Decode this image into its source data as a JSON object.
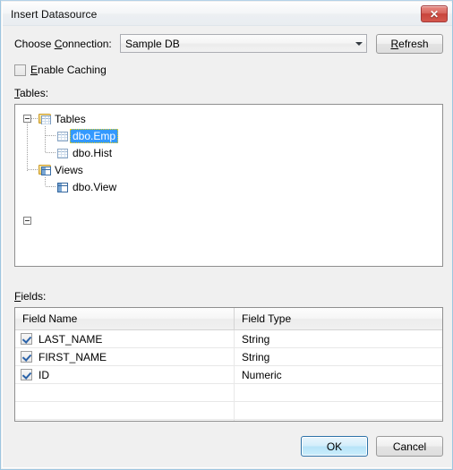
{
  "window": {
    "title": "Insert Datasource",
    "close_icon": "close-icon",
    "close_glyph": "✕"
  },
  "connection": {
    "label_pre": "Choose ",
    "label_mnemonic": "C",
    "label_post": "onnection:",
    "selected": "Sample DB",
    "dropdown_icon": "chevron-down-icon",
    "refresh_pre": "",
    "refresh_mnemonic": "R",
    "refresh_post": "efresh"
  },
  "caching": {
    "label_pre": "",
    "label_mnemonic": "E",
    "label_post": "nable Caching",
    "checked": false
  },
  "tables": {
    "label_mnemonic": "T",
    "label_post": "ables:",
    "nodes": [
      {
        "label": "Tables",
        "icon": "folder-table-icon",
        "level": 0,
        "expanded": true,
        "selected": false
      },
      {
        "label": "dbo.Emp",
        "icon": "table-icon",
        "level": 1,
        "expanded": false,
        "selected": true
      },
      {
        "label": "dbo.Hist",
        "icon": "table-icon",
        "level": 1,
        "expanded": false,
        "selected": false
      },
      {
        "label": "Views",
        "icon": "folder-view-icon",
        "level": 0,
        "expanded": true,
        "selected": false
      },
      {
        "label": "dbo.View",
        "icon": "view-icon",
        "level": 1,
        "expanded": false,
        "selected": false
      }
    ]
  },
  "fields": {
    "label_mnemonic": "F",
    "label_post": "ields:",
    "columns": [
      "Field Name",
      "Field Type"
    ],
    "rows": [
      {
        "checked": true,
        "name": "LAST_NAME",
        "type": "String"
      },
      {
        "checked": true,
        "name": "FIRST_NAME",
        "type": "String"
      },
      {
        "checked": true,
        "name": "ID",
        "type": "Numeric"
      }
    ],
    "empty_rows": 3
  },
  "footer": {
    "ok_label": "OK",
    "cancel_label": "Cancel"
  },
  "colors": {
    "accent": "#3399ff",
    "close_button": "#c8453c",
    "default_button_border": "#2c72a8"
  }
}
